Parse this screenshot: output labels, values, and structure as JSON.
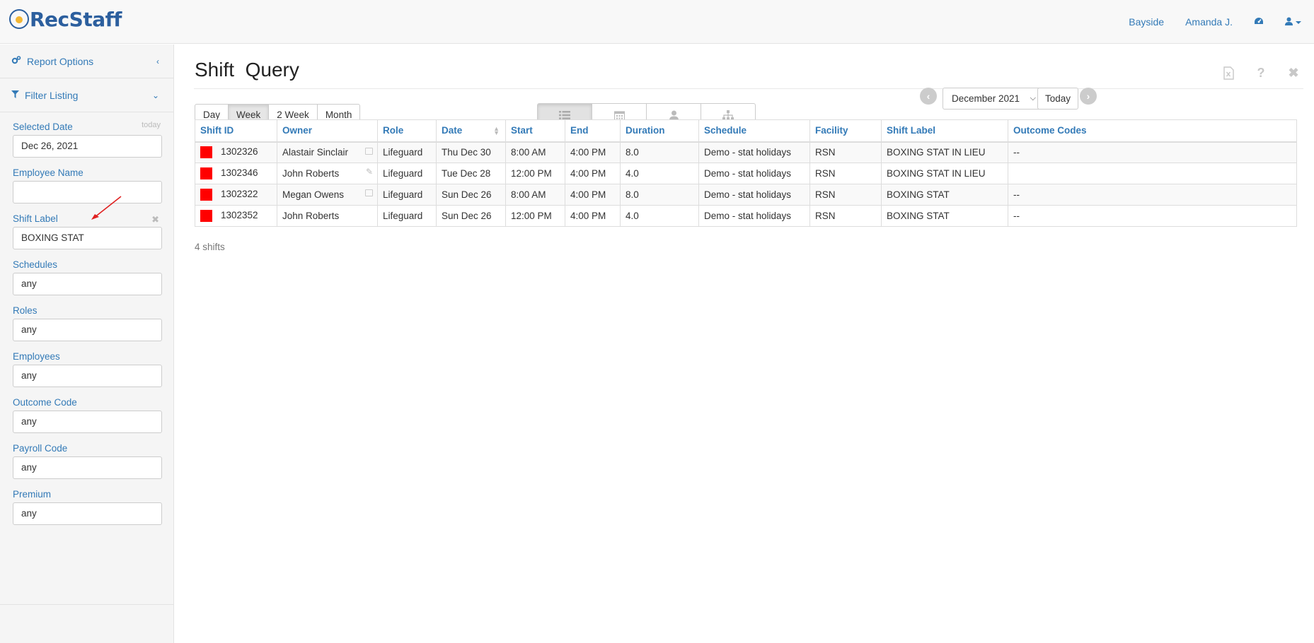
{
  "app": {
    "logo_text": "RecStaff"
  },
  "topnav": {
    "location": "Bayside",
    "user": "Amanda J."
  },
  "sidebar": {
    "report_options": "Report Options",
    "filter_listing": "Filter Listing",
    "filters": [
      {
        "label": "Selected Date",
        "hint": "today",
        "value": "Dec 26, 2021"
      },
      {
        "label": "Employee Name",
        "value": ""
      },
      {
        "label": "Shift Label",
        "value": "BOXING STAT"
      },
      {
        "label": "Schedules",
        "value": "any"
      },
      {
        "label": "Roles",
        "value": "any"
      },
      {
        "label": "Employees",
        "value": "any"
      },
      {
        "label": "Outcome Code",
        "value": "any"
      },
      {
        "label": "Payroll Code",
        "value": "any"
      },
      {
        "label": "Premium",
        "value": "any"
      }
    ]
  },
  "main": {
    "title_part1": "Shift",
    "title_part2": "Query",
    "range_buttons": [
      "Day",
      "Week",
      "2 Week",
      "Month"
    ],
    "active_range": "Week",
    "views": [
      "list-icon",
      "calendar-icon",
      "user-icon",
      "org-chart-icon"
    ],
    "month_select": "December 2021",
    "today_label": "Today",
    "columns": [
      "Shift ID",
      "Owner",
      "Role",
      "Date",
      "Start",
      "End",
      "Duration",
      "Schedule",
      "Facility",
      "Shift Label",
      "Outcome Codes"
    ],
    "rows": [
      {
        "id": "1302326",
        "owner": "Alastair Sinclair",
        "role": "Lifeguard",
        "date": "Thu Dec 30",
        "start": "8:00 AM",
        "end": "4:00 PM",
        "duration": "8.0",
        "schedule": "Demo - stat holidays",
        "facility": "RSN",
        "label": "BOXING STAT IN LIEU",
        "outcome": "--"
      },
      {
        "id": "1302346",
        "owner": "John Roberts",
        "role": "Lifeguard",
        "date": "Tue Dec 28",
        "start": "12:00 PM",
        "end": "4:00 PM",
        "duration": "4.0",
        "schedule": "Demo - stat holidays",
        "facility": "RSN",
        "label": "BOXING STAT IN LIEU",
        "outcome": ""
      },
      {
        "id": "1302322",
        "owner": "Megan Owens",
        "role": "Lifeguard",
        "date": "Sun Dec 26",
        "start": "8:00 AM",
        "end": "4:00 PM",
        "duration": "8.0",
        "schedule": "Demo - stat holidays",
        "facility": "RSN",
        "label": "BOXING STAT",
        "outcome": "--"
      },
      {
        "id": "1302352",
        "owner": "John Roberts",
        "role": "Lifeguard",
        "date": "Sun Dec 26",
        "start": "12:00 PM",
        "end": "4:00 PM",
        "duration": "4.0",
        "schedule": "Demo - stat holidays",
        "facility": "RSN",
        "label": "BOXING STAT",
        "outcome": "--"
      }
    ],
    "count_text": "4 shifts"
  },
  "colors": {
    "accent": "#337ab7",
    "shift_swatch": "#ff0000",
    "logo": "#2c5f9e"
  }
}
